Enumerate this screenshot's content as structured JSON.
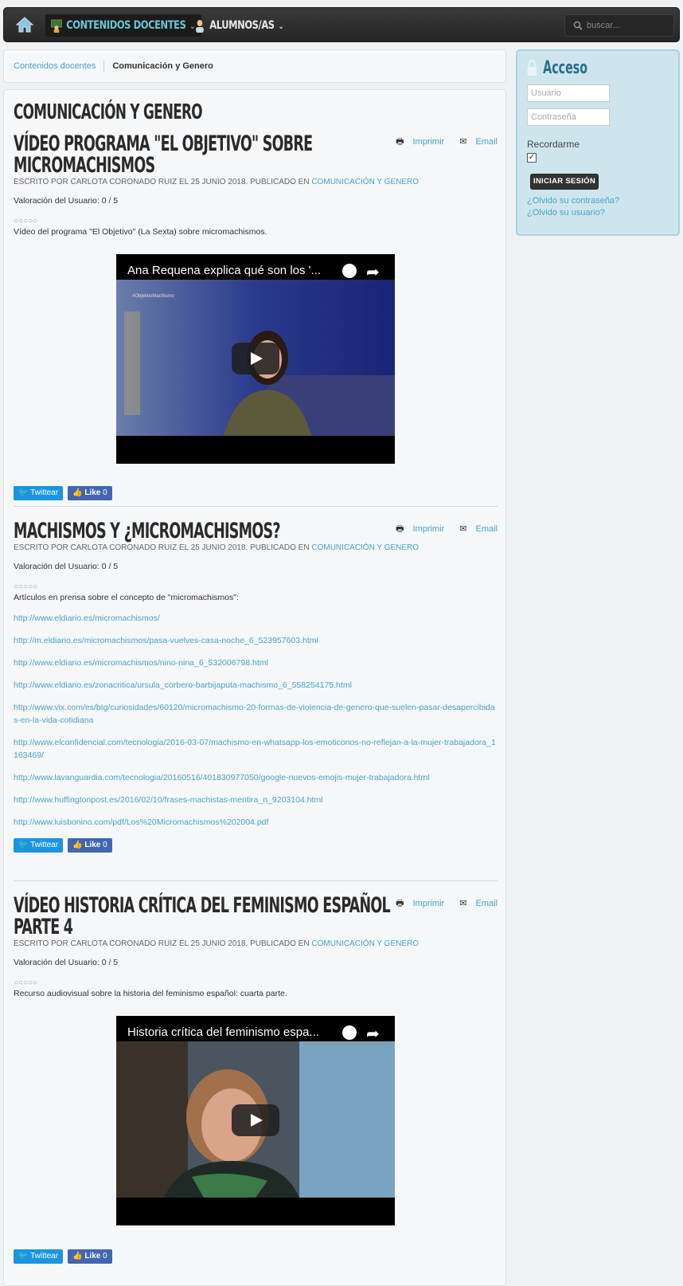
{
  "nav": {
    "items": [
      {
        "label": "Contenidos docentes",
        "icon": "teacher-board-icon"
      },
      {
        "label": "Alumnos/as",
        "icon": "student-icon"
      }
    ],
    "search_placeholder": "buscar..."
  },
  "breadcrumb": {
    "items": [
      "Contenidos docentes",
      "Comunicación y Genero"
    ]
  },
  "page_title": "Comunicación y Genero",
  "tools": {
    "print": "Imprimir",
    "email": "Email"
  },
  "articles": [
    {
      "title": "Vídeo programa \"El Objetivo\" sobre micromachismos",
      "meta_prefix": "Escrito por Carlota Coronado Ruiz el 25 Junio 2018. Publicado en ",
      "meta_category": "Comunicación y Genero",
      "rating": "Valoración del Usuario: 0 / 5",
      "stars": "○○○○○",
      "intro": "Vídeo del programa \"El Objetivo\" (La Sexta) sobre micromachismos.",
      "video_title": "Ana Requena explica qué son los '...",
      "video_tag": "#ObjetivoMachismo"
    },
    {
      "title": "Machismos y ¿micromachismos?",
      "meta_prefix": "Escrito por Carlota Coronado Ruiz el 25 Junio 2018. Publicado en ",
      "meta_category": "Comunicación y Genero",
      "rating": "Valoración del Usuario: 0 / 5",
      "stars": "○○○○○",
      "intro": "Artículos en prensa sobre el concepto de \"micromachismos\":",
      "links": [
        "http://www.eldiario.es/micromachismos/",
        "http://m.eldiario.es/micromachismos/pasa-vuelves-casa-noche_6_523957603.html",
        "http://www.eldiario.es/micromachismos/nino-nina_6_532006798.html",
        "http://www.eldiario.es/zonacritica/ursula_corbero-barbijaputa-machismo_6_558254175.html",
        "http://www.vix.com/es/btg/curiosidades/60120/micromachismo-20-formas-de-violencia-de-genero-que-suelen-pasar-desapercibidas-en-la-vida-cotidiana",
        "http://www.elconfidencial.com/tecnologia/2016-03-07/machismo-en-whatsapp-los-emoticonos-no-reflejan-a-la-mujer-trabajadora_1163469/",
        "http://www.lavanguardia.com/tecnologia/20160516/401830977050/google-nuevos-emojis-mujer-trabajadora.html",
        "http://www.huffingtonpost.es/2016/02/10/frases-machistas-mentira_n_9203104.html",
        "http://www.luisbonino.com/pdf/Los%20Micromachismos%202004.pdf"
      ]
    },
    {
      "title": "Vídeo Historia crítica del feminismo español parte 4",
      "meta_prefix": "Escrito por Carlota Coronado Ruiz el 25 Junio 2018. Publicado en ",
      "meta_category": "Comunicación y Genero",
      "rating": "Valoración del Usuario: 0 / 5",
      "stars": "○○○○○",
      "intro": "Recurso audiovisual sobre la historia del feminismo español: cuarta parte.",
      "video_title": "Historia crítica del feminismo espa..."
    }
  ],
  "social": {
    "twitter": "Twittear",
    "facebook": "Like",
    "fb_count": "0"
  },
  "login": {
    "title": "Acceso",
    "username_placeholder": "Usuario",
    "password_placeholder": "Contraseña",
    "remember": "Recordarme",
    "submit": "Iniciar sesión",
    "forgot_password": "¿Olvido su contraseña?",
    "forgot_username": "¿Olvido su usuario?"
  },
  "colors": {
    "accent": "#4aa3c5",
    "nav_bg": "#2b2b2b",
    "sidebar_bg": "#cfe5ee"
  }
}
